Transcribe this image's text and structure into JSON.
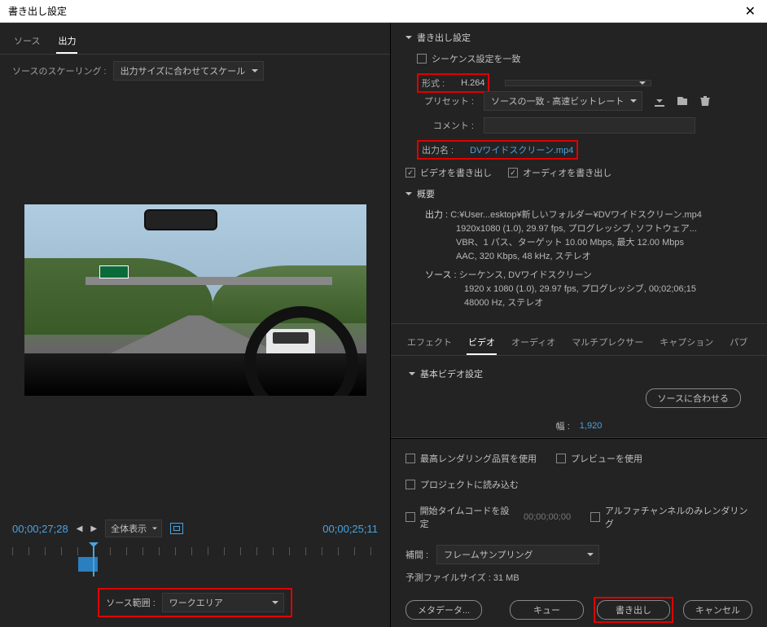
{
  "title": "書き出し設定",
  "left": {
    "tabs": [
      "ソース",
      "出力"
    ],
    "active_tab": 1,
    "scaling_label": "ソースのスケーリング :",
    "scaling_value": "出力サイズに合わせてスケール",
    "time_in": "00;00;27;28",
    "time_out": "00;00;25;11",
    "fit_label": "全体表示",
    "source_range_label": "ソース範囲 :",
    "source_range_value": "ワークエリア"
  },
  "export": {
    "section_title": "書き出し設定",
    "match_sequence": "シーケンス設定を一致",
    "format_label": "形式 :",
    "format_value": "H.264",
    "preset_label": "プリセット :",
    "preset_value": "ソースの一致 - 高速ビットレート",
    "comment_label": "コメント :",
    "output_name_label": "出力名 :",
    "output_name_value": "DVワイドスクリーン.mp4",
    "export_video": "ビデオを書き出し",
    "export_audio": "オーディオを書き出し"
  },
  "summary": {
    "title": "概要",
    "out_label": "出力 :",
    "out_path": "C:¥User...esktop¥新しいフォルダー¥DVワイドスクリーン.mp4",
    "out_l1": "1920x1080 (1.0), 29.97 fps, プログレッシブ, ソフトウェア...",
    "out_l2": "VBR、1 パス、ターゲット 10.00 Mbps, 最大 12.00 Mbps",
    "out_l3": "AAC, 320 Kbps, 48 kHz, ステレオ",
    "src_label": "ソース :",
    "src_l0": "シーケンス, DVワイドスクリーン",
    "src_l1": "1920 x 1080 (1.0), 29.97 fps, プログレッシブ, 00;02;06;15",
    "src_l2": "48000 Hz, ステレオ"
  },
  "rtabs": {
    "items": [
      "エフェクト",
      "ビデオ",
      "オーディオ",
      "マルチプレクサー",
      "キャプション",
      "パブ"
    ],
    "active": 1
  },
  "basic": {
    "title": "基本ビデオ設定",
    "match_source_btn": "ソースに合わせる",
    "width_label": "幅 :",
    "width_value": "1,920"
  },
  "bottom": {
    "max_quality": "最高レンダリング品質を使用",
    "use_preview": "プレビューを使用",
    "import_project": "プロジェクトに読み込む",
    "set_start_tc": "開始タイムコードを設定",
    "start_tc_value": "00;00;00;00",
    "alpha_only": "アルファチャンネルのみレンダリング",
    "interp_label": "補間 :",
    "interp_value": "フレームサンプリング",
    "est_size_label": "予測ファイルサイズ :",
    "est_size_value": "31 MB"
  },
  "buttons": {
    "metadata": "メタデータ...",
    "queue": "キュー",
    "export": "書き出し",
    "cancel": "キャンセル"
  }
}
